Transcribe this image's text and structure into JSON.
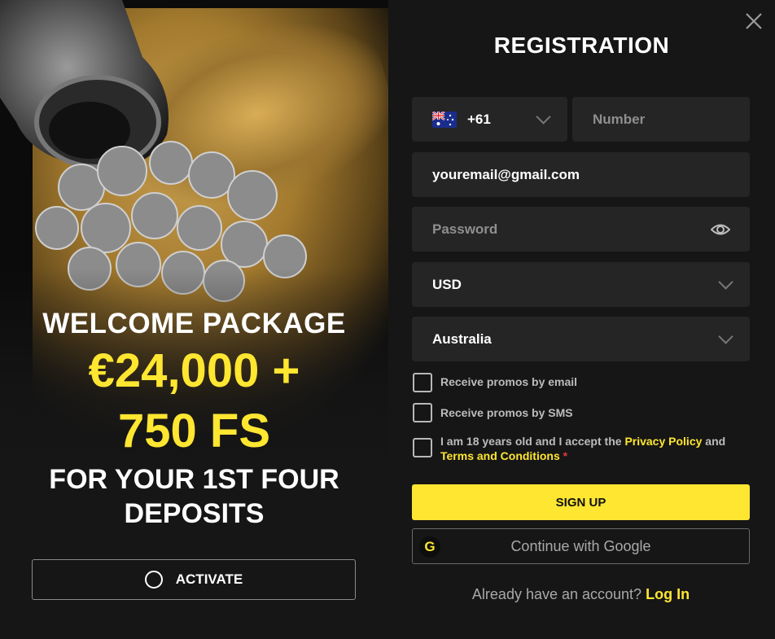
{
  "promo": {
    "welcome": "WELCOME PACKAGE",
    "amount": "€24,000 +",
    "free_spins": "750 FS",
    "subtitle_line1": "FOR YOUR 1ST FOUR",
    "subtitle_line2": "DEPOSITS",
    "activate_label": "ACTIVATE"
  },
  "form": {
    "title": "REGISTRATION",
    "phone_code": "+61",
    "phone_placeholder": "Number",
    "email_value": "youremail@gmail.com",
    "password_placeholder": "Password",
    "currency": "USD",
    "country": "Australia",
    "checkboxes": {
      "email_promos": "Receive promos by email",
      "sms_promos": "Receive promos by SMS",
      "age_prefix": "I am 18 years old and I accept the ",
      "privacy_link": "Privacy Policy",
      "and": " and",
      "terms_link": "Terms and Conditions",
      "required_mark": " *"
    },
    "signup_label": "SIGN UP",
    "google_label": "Continue with Google",
    "google_icon_letter": "G",
    "already_text": "Already have an account?",
    "login_link": "Log In"
  },
  "colors": {
    "accent": "#ffe631",
    "panel": "#161616",
    "field": "#252525"
  },
  "icons": [
    "close-icon",
    "australia-flag-icon",
    "chevron-down-icon",
    "eye-icon",
    "google-icon",
    "radio-circle-icon"
  ]
}
